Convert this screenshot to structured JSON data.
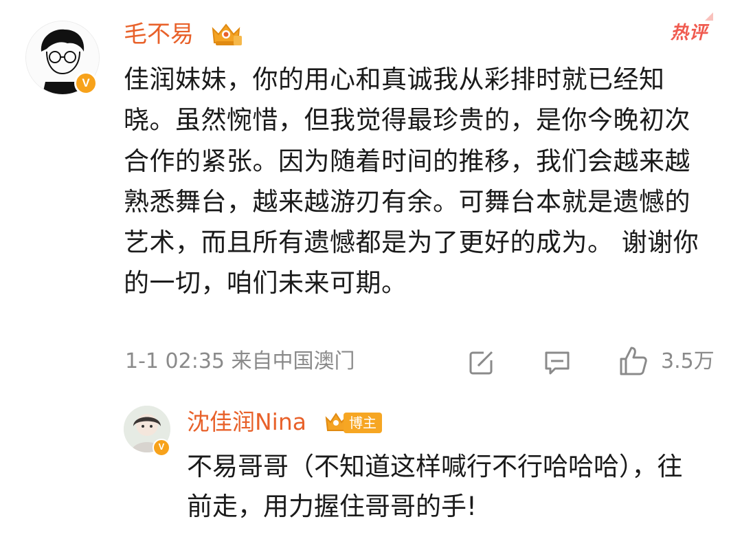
{
  "main_comment": {
    "username": "毛不易",
    "hot_label": "热评",
    "text": "佳润妹妹，你的用心和真诚我从彩排时就已经知晓。虽然惋惜，但我觉得最珍贵的，是你今晚初次合作的紧张。因为随着时间的推移，我们会越来越熟悉舞台，越来越游刃有余。可舞台本就是遗憾的艺术，而且所有遗憾都是为了更好的成为。 谢谢你的一切，咱们未来可期。",
    "meta": "1-1 02:35 来自中国澳门",
    "like_count": "3.5万",
    "verified_mark": "V",
    "icons": {
      "avatar": "avatar-image",
      "badge": "crown-badge-icon",
      "share": "share-icon",
      "comment": "comment-icon",
      "like": "like-icon"
    }
  },
  "reply": {
    "username": "沈佳润Nina",
    "badge_label": "博主",
    "text": "不易哥哥（不知道这样喊行不行哈哈哈），往前走，用力握住哥哥的手!",
    "verified_mark": "V"
  },
  "colors": {
    "username": "#e8612a",
    "hot_label": "#f05a4f",
    "meta_text": "#8a8a8a",
    "verified_badge": "#f7a21b",
    "blogger_badge": "#f6a623"
  }
}
